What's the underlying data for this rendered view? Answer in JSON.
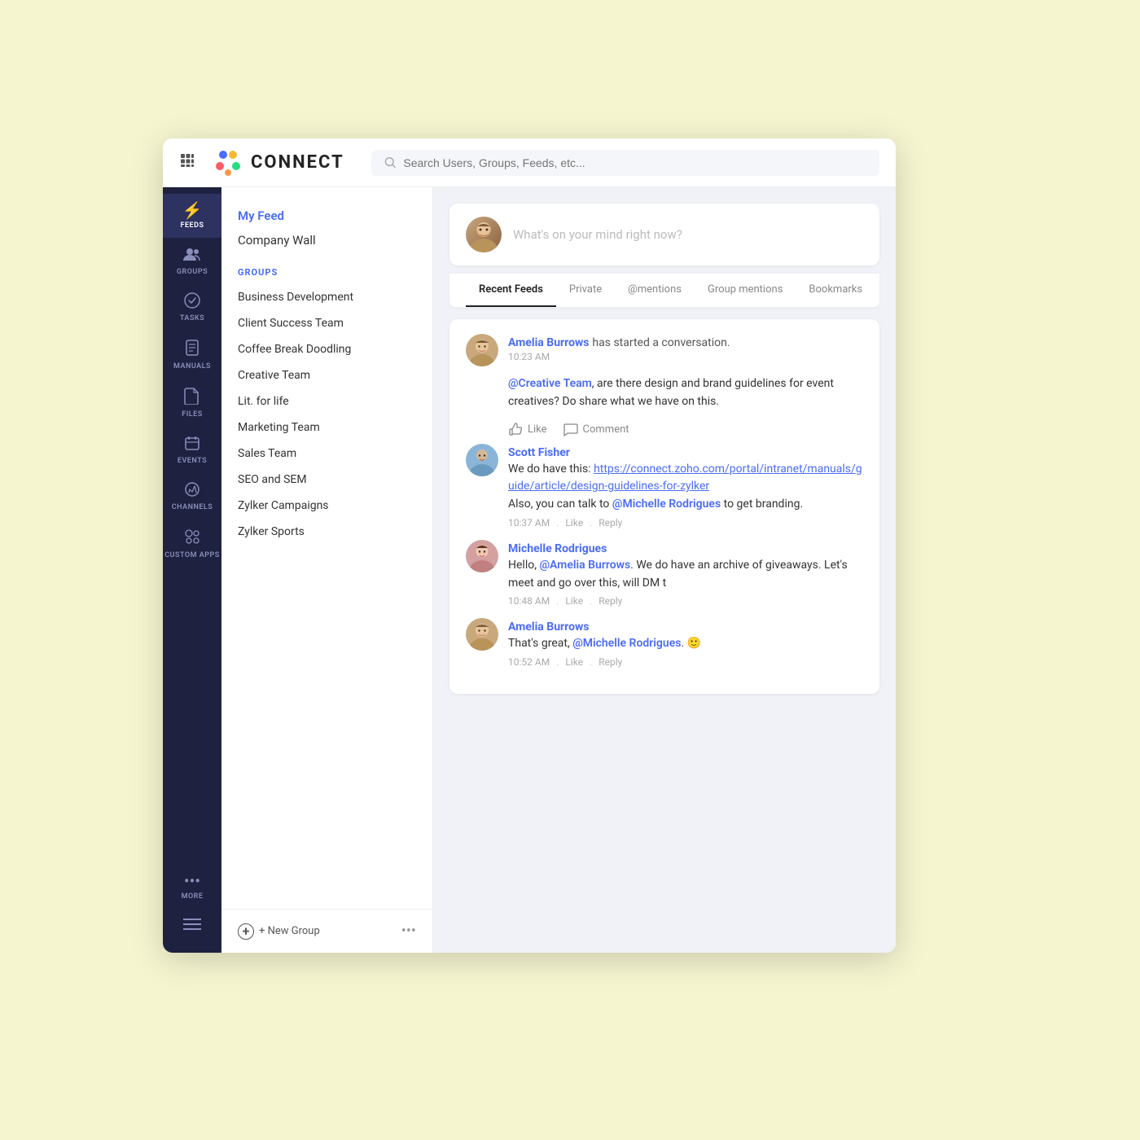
{
  "header": {
    "grid_icon": "⋮⋮",
    "logo_text": "CONNECT",
    "search_placeholder": "Search Users, Groups, Feeds, etc..."
  },
  "sidebar": {
    "items": [
      {
        "id": "feeds",
        "label": "FEEDS",
        "icon": "⚡",
        "active": true
      },
      {
        "id": "groups",
        "label": "GROUPS",
        "icon": "👥",
        "active": false
      },
      {
        "id": "tasks",
        "label": "TASKS",
        "icon": "✅",
        "active": false
      },
      {
        "id": "manuals",
        "label": "MANUALS",
        "icon": "📋",
        "active": false
      },
      {
        "id": "files",
        "label": "FILES",
        "icon": "📁",
        "active": false
      },
      {
        "id": "events",
        "label": "EVENTS",
        "icon": "📅",
        "active": false
      },
      {
        "id": "channels",
        "label": "CHANNELS",
        "icon": "💬",
        "active": false
      },
      {
        "id": "custom_apps",
        "label": "CUSTOM APPS",
        "icon": "⚙",
        "active": false
      },
      {
        "id": "more",
        "label": "MORE",
        "icon": "•••",
        "active": false
      }
    ],
    "bottom_icon": "☰"
  },
  "middle_panel": {
    "my_feed_label": "My Feed",
    "company_wall_label": "Company Wall",
    "groups_section_label": "GROUPS",
    "groups": [
      {
        "name": "Business Development"
      },
      {
        "name": "Client Success Team"
      },
      {
        "name": "Coffee Break Doodling"
      },
      {
        "name": "Creative Team"
      },
      {
        "name": "Lit. for life"
      },
      {
        "name": "Marketing Team"
      },
      {
        "name": "Sales Team"
      },
      {
        "name": "SEO and SEM"
      },
      {
        "name": "Zylker Campaigns"
      },
      {
        "name": "Zylker Sports"
      }
    ],
    "new_group_label": "+ New Group",
    "more_options_icon": "•••"
  },
  "feed_area": {
    "post_placeholder": "What's on your mind right now?",
    "tabs": [
      {
        "label": "Recent Feeds",
        "active": true
      },
      {
        "label": "Private",
        "active": false
      },
      {
        "label": "@mentions",
        "active": false
      },
      {
        "label": "Group mentions",
        "active": false
      },
      {
        "label": "Bookmarks",
        "active": false
      }
    ],
    "posts": [
      {
        "id": "post1",
        "author": "Amelia Burrows",
        "action": "has started a conversation.",
        "time": "10:23 AM",
        "body_parts": [
          {
            "type": "mention",
            "text": "@Creative Team"
          },
          {
            "type": "text",
            "text": ", are there design and brand guidelines for event creatives? Do share what we have on this."
          }
        ],
        "like_label": "Like",
        "comment_label": "Comment",
        "comments": [
          {
            "author": "Scott Fisher",
            "body_parts": [
              {
                "type": "text",
                "text": "We do have this: "
              },
              {
                "type": "link",
                "text": "https://connect.zoho.com/portal/intranet/manuals/guide/article/design-guidelines-for-zylker"
              },
              {
                "type": "text",
                "text": "\nAlso, you can talk to "
              },
              {
                "type": "mention",
                "text": "@Michelle Rodrigues"
              },
              {
                "type": "text",
                "text": " to get branding."
              }
            ],
            "time": "10:37 AM",
            "like_label": "Like",
            "reply_label": "Reply"
          },
          {
            "author": "Michelle Rodrigues",
            "body_parts": [
              {
                "type": "text",
                "text": "Hello, "
              },
              {
                "type": "mention",
                "text": "@Amelia Burrows"
              },
              {
                "type": "text",
                "text": ". We do have an archive of giveaways. Let's meet and go over this, will DM t"
              }
            ],
            "time": "10:48 AM",
            "like_label": "Like",
            "reply_label": "Reply"
          },
          {
            "author": "Amelia Burrows",
            "body_parts": [
              {
                "type": "text",
                "text": "That's great, "
              },
              {
                "type": "mention",
                "text": "@Michelle Rodrigues"
              },
              {
                "type": "text",
                "text": ". 🙂"
              }
            ],
            "time": "10:52 AM",
            "like_label": "Like",
            "reply_label": "Reply"
          }
        ]
      }
    ]
  }
}
